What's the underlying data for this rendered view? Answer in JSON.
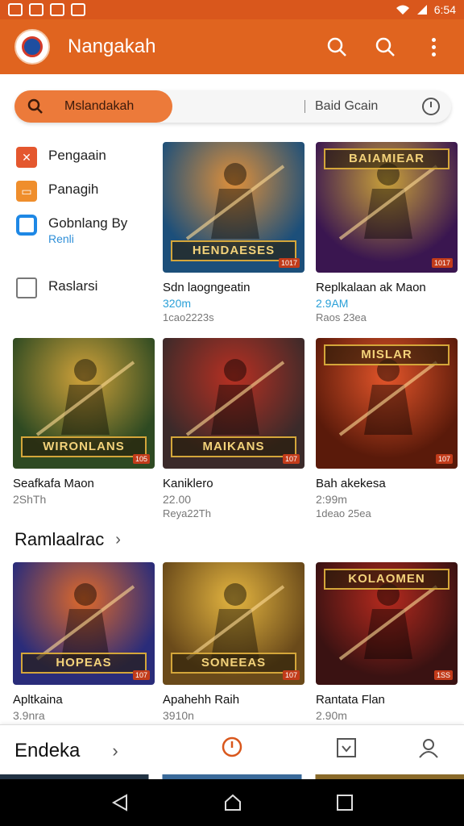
{
  "status_bar": {
    "time": "6:54"
  },
  "app": {
    "title": "Nangakah"
  },
  "search": {
    "pill_label": "Mslandakah",
    "secondary_label": "Baid Gcain"
  },
  "filters": [
    {
      "label": "Pengaain",
      "icon": "x-icon"
    },
    {
      "label": "Panagih",
      "icon": "folder-icon"
    },
    {
      "label": "Gobnlang By",
      "sub": "Renli",
      "icon": "checkbox-checked-icon"
    },
    {
      "label": "Raslarsi",
      "icon": "checkbox-icon"
    }
  ],
  "cards": [
    {
      "title": "Sdn laogngeatin",
      "meta": "320m",
      "sub": "1cao2223s",
      "banner": "HENDAESES",
      "badge": "1017",
      "colors": [
        "#1c4f7a",
        "#e0903a"
      ]
    },
    {
      "title": "Replkalaan ak Maon",
      "meta": "2.9AM",
      "sub": "Raos 23ea",
      "banner": "BAIAMIEAR",
      "badge": "1017",
      "colors": [
        "#3a1650",
        "#c9a13a"
      ]
    },
    {
      "title": "Seafkafa Maon",
      "meta": "2ShTh",
      "sub": "",
      "banner": "WIRONLANS",
      "badge": "105",
      "colors": [
        "#2e4a22",
        "#d1a23a"
      ]
    },
    {
      "title": "Kaniklero",
      "meta": "22.00",
      "sub": "Reya22Th",
      "banner": "MAIKANS",
      "badge": "107",
      "colors": [
        "#3b2a2a",
        "#b83022"
      ]
    },
    {
      "title": "Bah akekesa",
      "meta": "2:99m",
      "sub": "1deao 25ea",
      "banner": "MISLAR",
      "badge": "107",
      "colors": [
        "#5a1a0a",
        "#e3552a"
      ]
    },
    {
      "title": "Apltkaina",
      "meta": "3.9nra",
      "sub": "",
      "banner": "HOPEAS",
      "badge": "107",
      "colors": [
        "#2a2c7a",
        "#e06a2a"
      ]
    },
    {
      "title": "Apahehh Raih",
      "meta": "3910n",
      "sub": "",
      "banner": "SONEEAS",
      "badge": "107",
      "colors": [
        "#6a4a1a",
        "#e4b540"
      ]
    },
    {
      "title": "Rantata Flan",
      "meta": "2.90m",
      "sub": "",
      "banner": "KOLAOMEN",
      "badge": "1SS",
      "colors": [
        "#3a1212",
        "#b52a1e"
      ]
    }
  ],
  "section": {
    "title": "Ramlaalrac"
  },
  "bottom_nav": {
    "label": "Endeka"
  }
}
